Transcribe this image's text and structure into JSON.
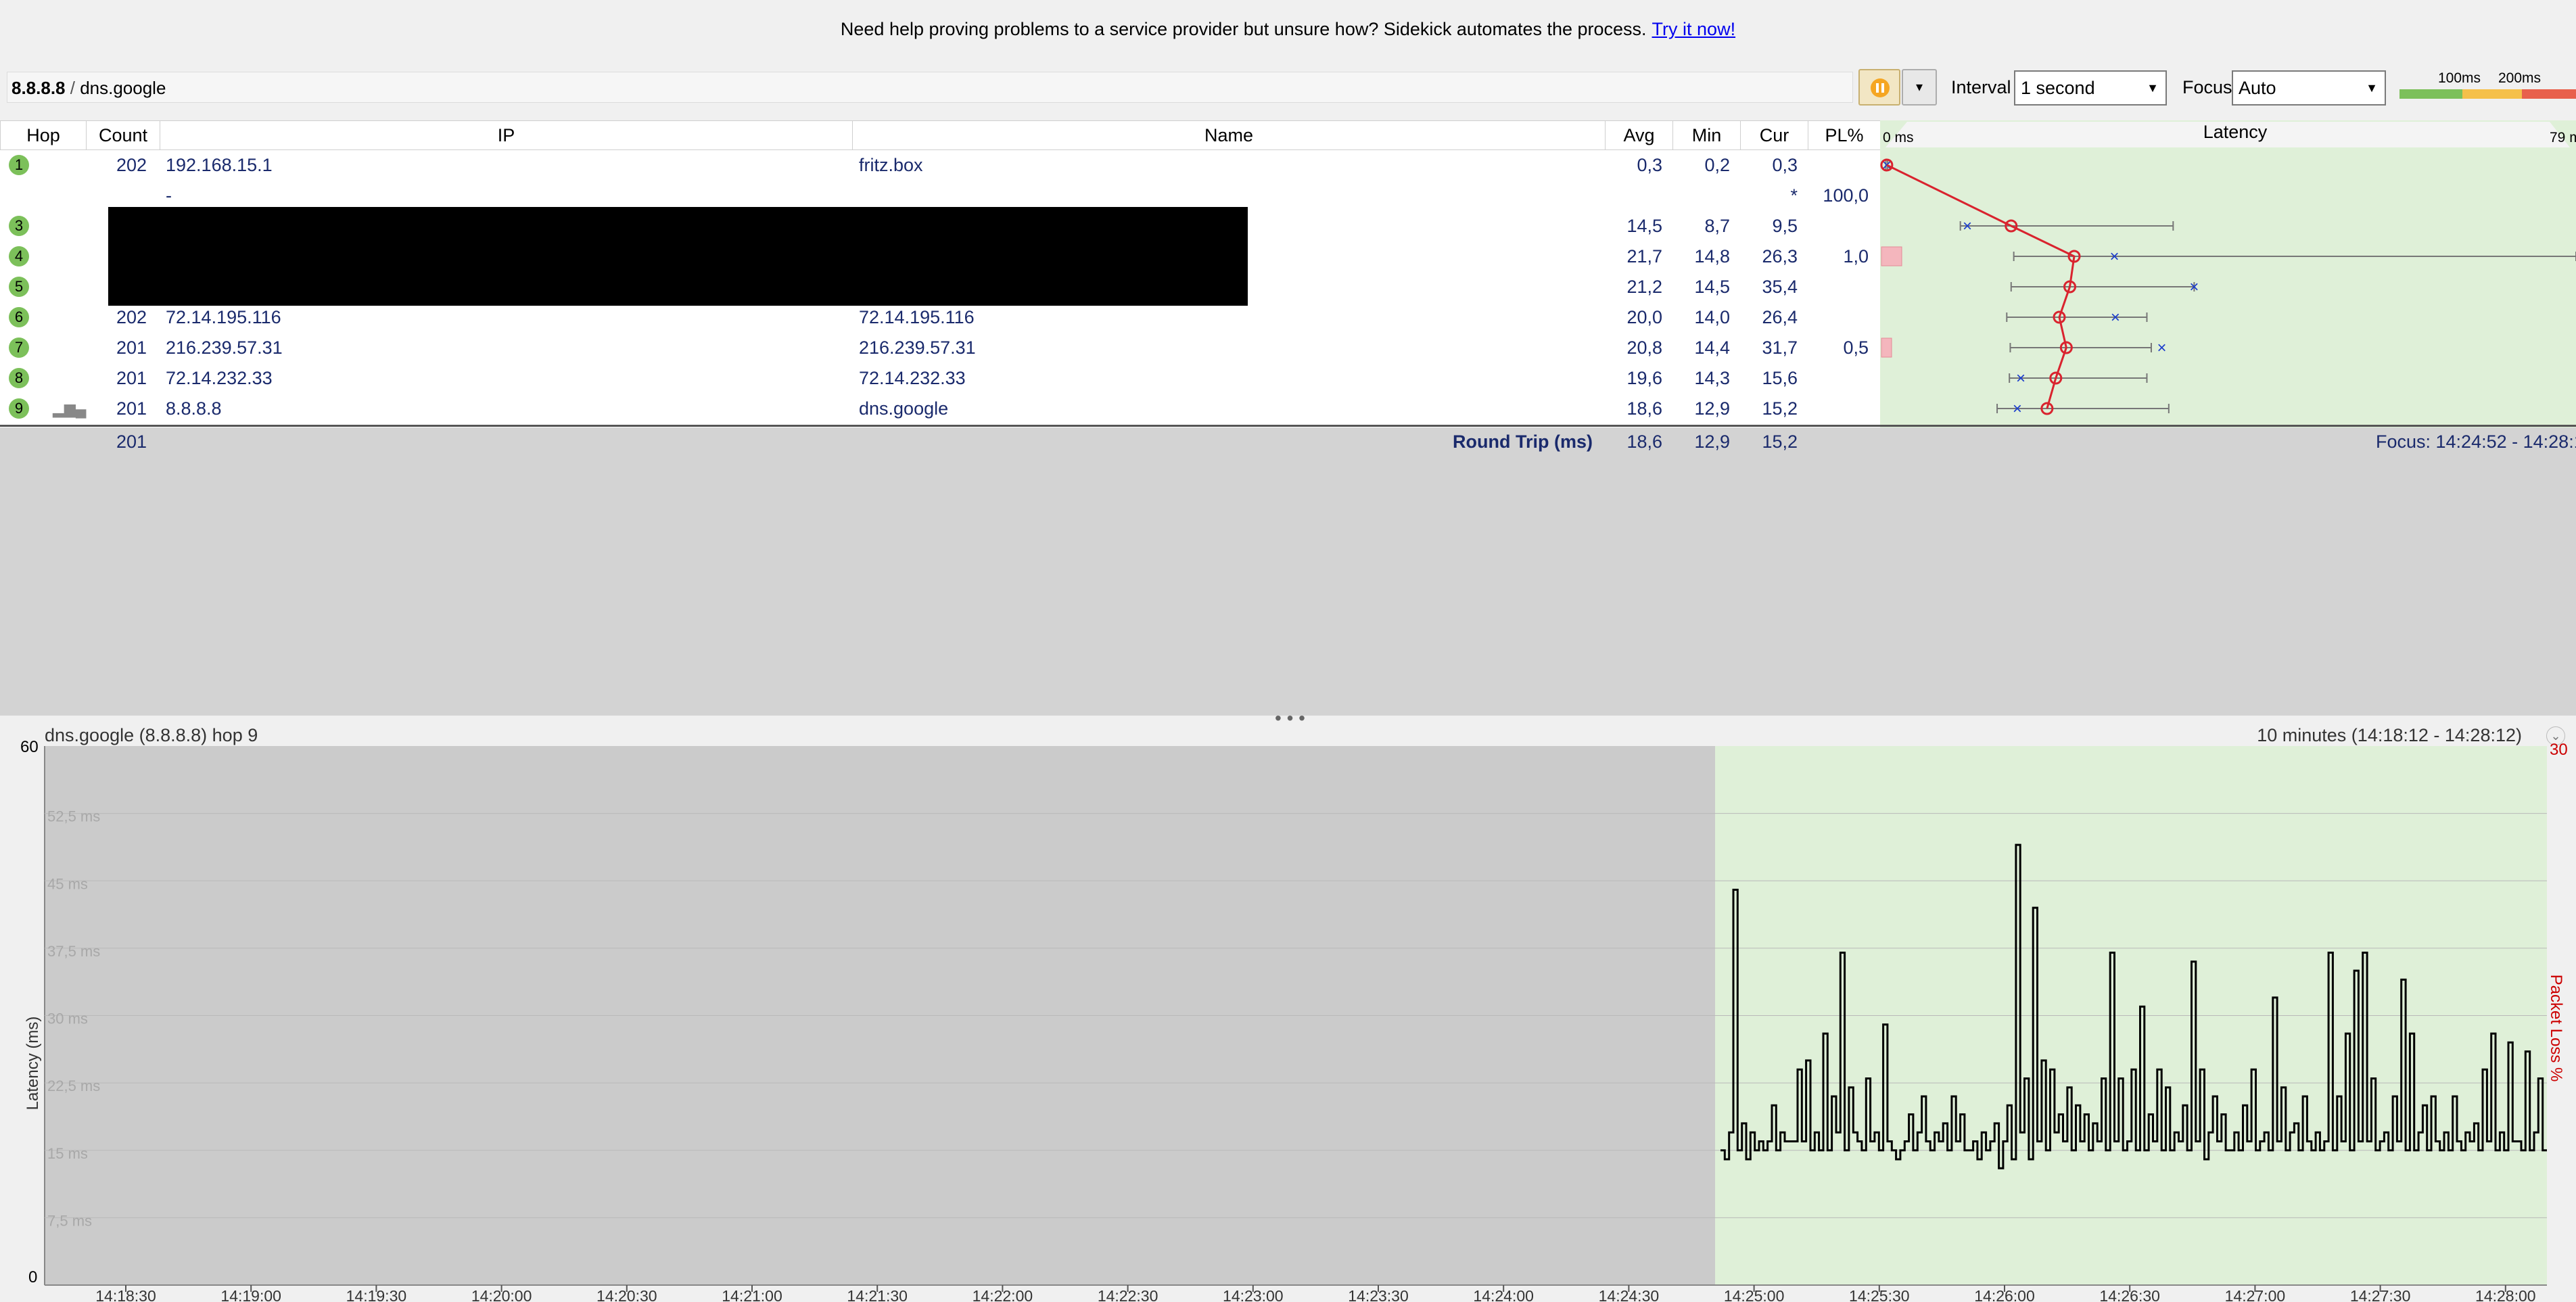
{
  "banner": {
    "text": "Need help proving problems to a service provider but unsure how? Sidekick automates the process.",
    "link": "Try it now!"
  },
  "toolbar": {
    "target_ip": "8.8.8.8",
    "target_sep": " / ",
    "target_name": "dns.google",
    "interval_label": "Interval",
    "interval_value": "1 second",
    "focus_label": "Focus",
    "focus_value": "Auto",
    "legend_100": "100ms",
    "legend_200": "200ms",
    "legend_colors": [
      "#7cc05a",
      "#f5c04a",
      "#e8604c"
    ]
  },
  "table": {
    "headers": {
      "hop": "Hop",
      "count": "Count",
      "ip": "IP",
      "name": "Name",
      "avg": "Avg",
      "min": "Min",
      "cur": "Cur",
      "pl": "PL%",
      "latency": "Latency",
      "lat_min": "0 ms",
      "lat_max": "79 ms"
    },
    "rows": [
      {
        "hop": "1",
        "count": "202",
        "ip": "192.168.15.1",
        "name": "fritz.box",
        "avg": "0,3",
        "min": "0,2",
        "cur": "0,3",
        "pl": ""
      },
      {
        "hop": "",
        "count": "",
        "ip": "-",
        "name": "",
        "avg": "",
        "min": "",
        "cur": "*",
        "pl": "100,0"
      },
      {
        "hop": "3",
        "count": "",
        "ip": "",
        "name": "",
        "avg": "14,5",
        "min": "8,7",
        "cur": "9,5",
        "pl": ""
      },
      {
        "hop": "4",
        "count": "",
        "ip": "",
        "name": "",
        "avg": "21,7",
        "min": "14,8",
        "cur": "26,3",
        "pl": "1,0"
      },
      {
        "hop": "5",
        "count": "",
        "ip": "",
        "name": "",
        "avg": "21,2",
        "min": "14,5",
        "cur": "35,4",
        "pl": ""
      },
      {
        "hop": "6",
        "count": "202",
        "ip": "72.14.195.116",
        "name": "72.14.195.116",
        "avg": "20,0",
        "min": "14,0",
        "cur": "26,4",
        "pl": ""
      },
      {
        "hop": "7",
        "count": "201",
        "ip": "216.239.57.31",
        "name": "216.239.57.31",
        "avg": "20,8",
        "min": "14,4",
        "cur": "31,7",
        "pl": "0,5"
      },
      {
        "hop": "8",
        "count": "201",
        "ip": "72.14.232.33",
        "name": "72.14.232.33",
        "avg": "19,6",
        "min": "14,3",
        "cur": "15,6",
        "pl": ""
      },
      {
        "hop": "9",
        "count": "201",
        "ip": "8.8.8.8",
        "name": "dns.google",
        "avg": "18,6",
        "min": "12,9",
        "cur": "15,2",
        "pl": ""
      }
    ],
    "summary": {
      "count": "201",
      "label": "Round Trip (ms)",
      "avg": "18,6",
      "min": "12,9",
      "cur": "15,2",
      "focus": "Focus: 14:24:52 - 14:28:12"
    }
  },
  "latency_chart": {
    "range_ms": [
      0,
      79
    ],
    "avg": [
      0.3,
      null,
      14.5,
      21.7,
      21.2,
      20.0,
      20.8,
      19.6,
      18.6
    ],
    "min": [
      0.2,
      null,
      8.7,
      14.8,
      14.5,
      14.0,
      14.4,
      14.3,
      12.9
    ],
    "cur": [
      0.3,
      null,
      9.5,
      26.3,
      35.4,
      26.4,
      31.7,
      15.6,
      15.2
    ],
    "max": [
      0.4,
      null,
      33,
      79,
      35.4,
      30,
      30.5,
      30,
      32.5
    ],
    "pl": [
      0,
      100,
      0,
      1.0,
      0,
      0,
      0.5,
      0,
      0
    ]
  },
  "graph": {
    "title": "dns.google (8.8.8.8) hop 9",
    "range": "10 minutes (14:18:12 - 14:28:12)",
    "ylabel": "Latency (ms)",
    "y2label": "Packet Loss %",
    "y_top": "60",
    "y_bottom": "0",
    "y2_top": "30",
    "grid_labels": [
      "52,5 ms",
      "45 ms",
      "37,5 ms",
      "30 ms",
      "22,5 ms",
      "15 ms",
      "7,5 ms"
    ],
    "x_labels": [
      "14:18:30",
      "14:19:00",
      "14:19:30",
      "14:20:00",
      "14:20:30",
      "14:21:00",
      "14:21:30",
      "14:22:00",
      "14:22:30",
      "14:23:00",
      "14:23:30",
      "14:24:00",
      "14:24:30",
      "14:25:00",
      "14:25:30",
      "14:26:00",
      "14:26:30",
      "14:27:00",
      "14:27:30",
      "14:28:00"
    ]
  },
  "chart_data": {
    "type": "line",
    "xlabel": "",
    "ylabel": "Latency (ms)",
    "y2label": "Packet Loss %",
    "ylim": [
      0,
      60
    ],
    "y2lim": [
      0,
      30
    ],
    "x_start": "14:24:52",
    "x_end": "14:28:12",
    "series": [
      {
        "name": "",
        "values": [
          15,
          14,
          17,
          44,
          15,
          18,
          14,
          17,
          15,
          16,
          15,
          16,
          20,
          15,
          17,
          16,
          16,
          16,
          24,
          16,
          25,
          15,
          17,
          15,
          28,
          15,
          21,
          17,
          37,
          15,
          22,
          17,
          16,
          15,
          23,
          16,
          17,
          15,
          29,
          16,
          15,
          14,
          15,
          16,
          19,
          15,
          17,
          21,
          16,
          15,
          17,
          16,
          18,
          15,
          21,
          16,
          19,
          15,
          15,
          16,
          14,
          17,
          15,
          16,
          18,
          13,
          16,
          20,
          14,
          49,
          17,
          23,
          14,
          42,
          16,
          25,
          15,
          24,
          17,
          19,
          16,
          22,
          15,
          20,
          16,
          19,
          15,
          18,
          16,
          23,
          15,
          37,
          16,
          23,
          15,
          16,
          24,
          15,
          31,
          15,
          19,
          16,
          24,
          15,
          22,
          15,
          17,
          16,
          20,
          15,
          36,
          16,
          24,
          14,
          17,
          21,
          16,
          19,
          15,
          15,
          17,
          15,
          20,
          16,
          24,
          15,
          16,
          17,
          15,
          32,
          16,
          22,
          15,
          17,
          18,
          15,
          21,
          16,
          15,
          17,
          15,
          16,
          37,
          15,
          21,
          16,
          28,
          15,
          35,
          16,
          37,
          16,
          23,
          15,
          16,
          17,
          15,
          21,
          16,
          34,
          15,
          28,
          15,
          17,
          20,
          15,
          21,
          16,
          15,
          17,
          15,
          21,
          16,
          15,
          17,
          16,
          18,
          15,
          24,
          16,
          28,
          15,
          17,
          15,
          27,
          16,
          16,
          15,
          26,
          15,
          17,
          23,
          15
        ]
      }
    ]
  }
}
